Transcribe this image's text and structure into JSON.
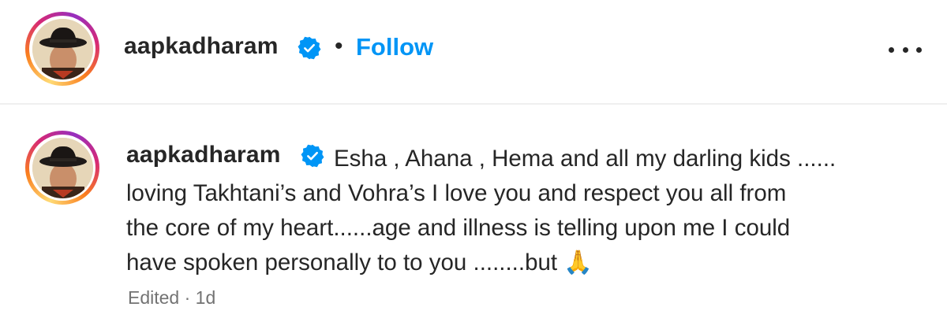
{
  "post_header": {
    "username": "aapkadharam",
    "separator": "•",
    "follow_label": "Follow",
    "more_icon": "more-horizontal-icon"
  },
  "comment": {
    "username": "aapkadharam",
    "lines": [
      "Esha , Ahana , Hema and all my darling kids ......",
      "loving Takhtani’s and Vohra’s I love you and respect you all from",
      "the core of my heart......age and illness is telling upon me I could",
      "have spoken personally to to you ........but 🙏"
    ],
    "meta": "Edited · 1d"
  },
  "colors": {
    "follow_blue": "#0095f6",
    "verified_blue": "#0095f6",
    "text": "#262626",
    "meta_gray": "#737373"
  }
}
